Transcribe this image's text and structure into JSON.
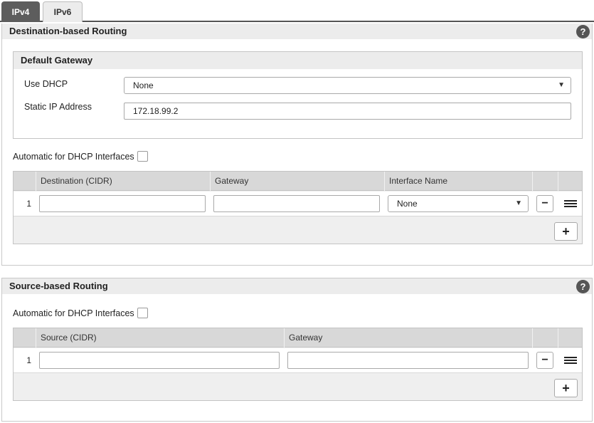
{
  "tabs": [
    {
      "label": "IPv4",
      "active": true
    },
    {
      "label": "IPv6",
      "active": false
    }
  ],
  "destination": {
    "title": "Destination-based Routing",
    "help": "?",
    "default_gateway": {
      "title": "Default Gateway",
      "use_dhcp_label": "Use DHCP",
      "use_dhcp_value": "None",
      "static_ip_label": "Static IP Address",
      "static_ip_value": "172.18.99.2"
    },
    "auto_dhcp_label": "Automatic for DHCP Interfaces",
    "table": {
      "columns": [
        "Destination (CIDR)",
        "Gateway",
        "Interface Name"
      ],
      "rows": [
        {
          "index": "1",
          "destination": "",
          "gateway": "",
          "interface": "None"
        }
      ],
      "remove_label": "−",
      "add_label": "+"
    }
  },
  "source": {
    "title": "Source-based Routing",
    "help": "?",
    "auto_dhcp_label": "Automatic for DHCP Interfaces",
    "table": {
      "columns": [
        "Source (CIDR)",
        "Gateway"
      ],
      "rows": [
        {
          "index": "1",
          "source": "",
          "gateway": ""
        }
      ],
      "remove_label": "−",
      "add_label": "+"
    }
  }
}
